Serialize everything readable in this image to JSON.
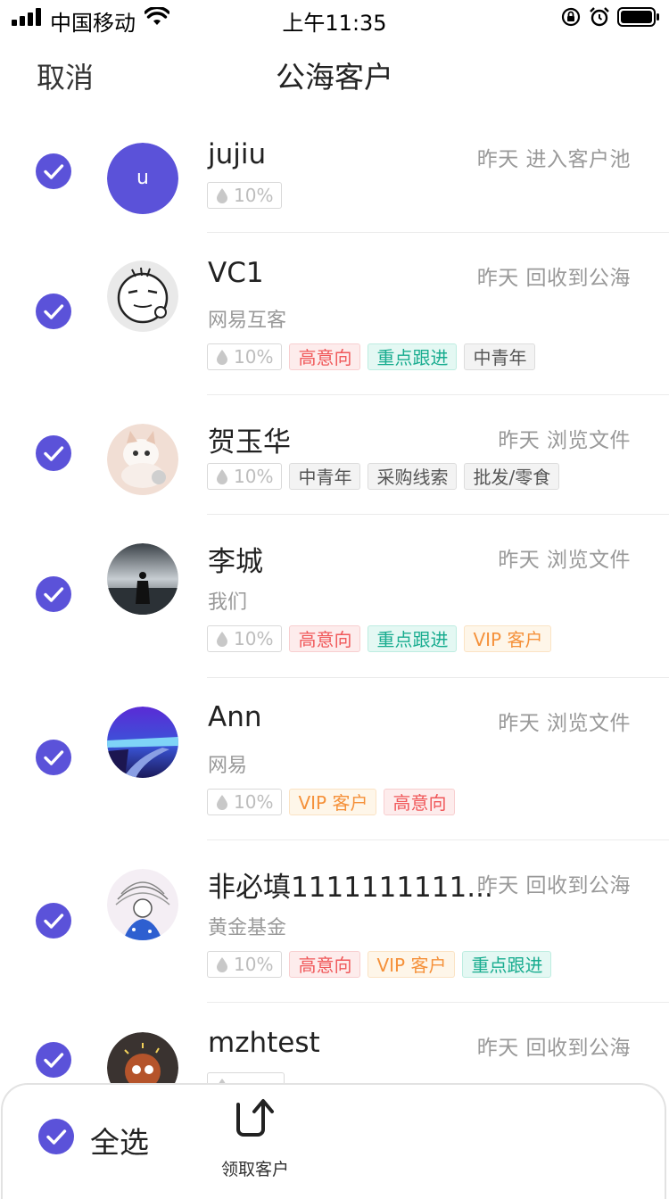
{
  "status_bar": {
    "carrier": "中国移动",
    "time": "上午11:35"
  },
  "nav": {
    "cancel_label": "取消",
    "title": "公海客户"
  },
  "customers": [
    {
      "name": "jujiu",
      "activity": "昨天 进入客户池",
      "company": "",
      "avatar_letter": "u",
      "intent": "10%",
      "tags": []
    },
    {
      "name": "VC1",
      "activity": "昨天 回收到公海",
      "company": "网易互客",
      "avatar_letter": "",
      "intent": "10%",
      "tags": [
        {
          "label": "高意向",
          "kind": "high"
        },
        {
          "label": "重点跟进",
          "kind": "focus"
        },
        {
          "label": "中青年",
          "kind": "gray"
        }
      ]
    },
    {
      "name": "贺玉华",
      "activity": "昨天 浏览文件",
      "company": "",
      "avatar_letter": "",
      "intent": "10%",
      "tags": [
        {
          "label": "中青年",
          "kind": "gray"
        },
        {
          "label": "采购线索",
          "kind": "gray"
        },
        {
          "label": "批发/零食",
          "kind": "gray"
        }
      ]
    },
    {
      "name": "李城",
      "activity": "昨天 浏览文件",
      "company": "我们",
      "avatar_letter": "",
      "intent": "10%",
      "tags": [
        {
          "label": "高意向",
          "kind": "high"
        },
        {
          "label": "重点跟进",
          "kind": "focus"
        },
        {
          "label": "VIP 客户",
          "kind": "vip"
        }
      ]
    },
    {
      "name": "Ann",
      "activity": "昨天 浏览文件",
      "company": "网易",
      "avatar_letter": "",
      "intent": "10%",
      "tags": [
        {
          "label": "VIP 客户",
          "kind": "vip"
        },
        {
          "label": "高意向",
          "kind": "high"
        }
      ]
    },
    {
      "name": "非必填1111111111...",
      "activity": "昨天 回收到公海",
      "company": "黄金基金",
      "avatar_letter": "",
      "intent": "10%",
      "tags": [
        {
          "label": "高意向",
          "kind": "high"
        },
        {
          "label": "VIP 客户",
          "kind": "vip"
        },
        {
          "label": "重点跟进",
          "kind": "focus"
        }
      ]
    },
    {
      "name": "mzhtest",
      "activity": "昨天 回收到公海",
      "company": "",
      "avatar_letter": "",
      "intent": "",
      "tags": []
    }
  ],
  "bottom_bar": {
    "select_all_label": "全选",
    "claim_label": "领取客户"
  },
  "colors": {
    "accent": "#5B52D9",
    "high_intent": "#F0585A",
    "focus": "#18AC8F",
    "vip": "#F5913A"
  }
}
